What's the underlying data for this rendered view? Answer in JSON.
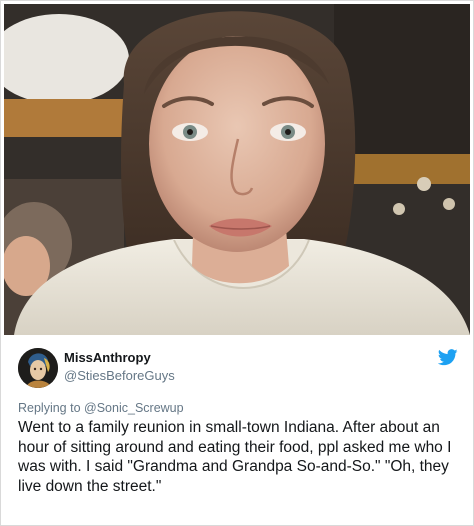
{
  "photo": {
    "description_icon": "photo-of-woman-icon"
  },
  "tweet": {
    "display_name": "MissAnthropy",
    "handle": "@StiesBeforeGuys",
    "reply_prefix": "Replying to",
    "reply_to": "@Sonic_Screwup",
    "text": "Went to a family reunion in small-town Indiana. After about an hour of sitting around and eating their food, ppl asked me who I was with. I said \"Grandma and Grandpa So-and-So.\" \"Oh, they live down the street.\"",
    "brand_icon": "twitter-bird-icon",
    "colors": {
      "brand": "#1da1f2",
      "secondary_text": "#657786",
      "primary_text": "#14171a"
    }
  }
}
